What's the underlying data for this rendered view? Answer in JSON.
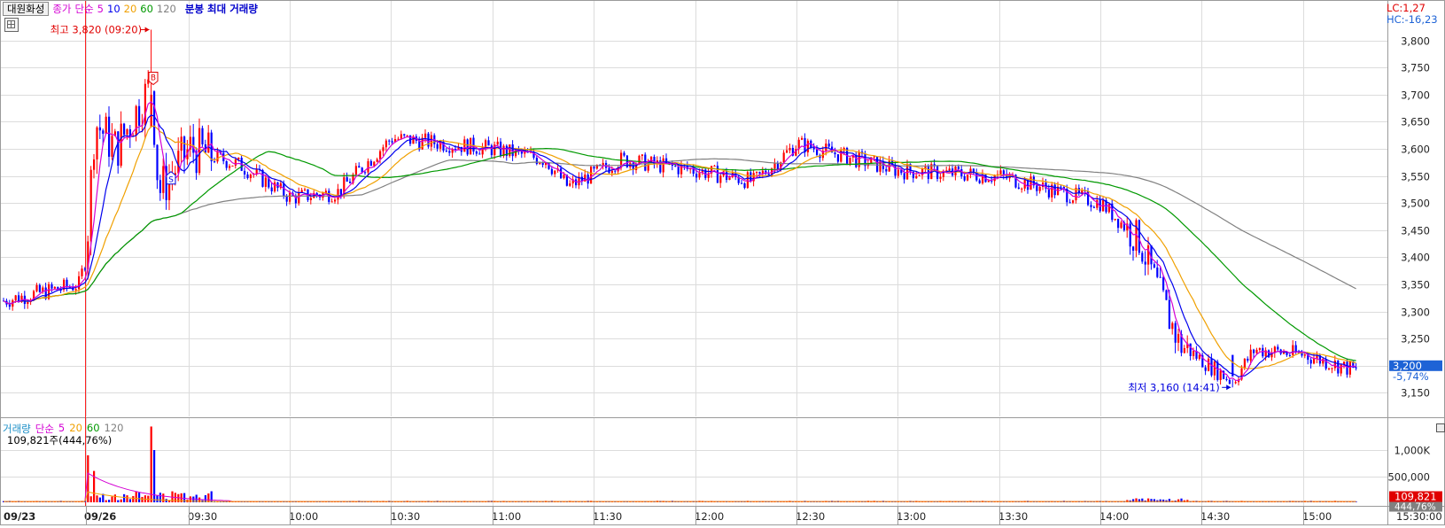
{
  "header": {
    "stock_name": "대원화성",
    "indicators": [
      {
        "label": "종가",
        "color": "#d400d4"
      },
      {
        "label": "단순",
        "color": "#d400d4"
      },
      {
        "label": "5",
        "color": "#d400d4"
      },
      {
        "label": "10",
        "color": "#0000ee"
      },
      {
        "label": "20",
        "color": "#f0a000"
      },
      {
        "label": "60",
        "color": "#009900"
      },
      {
        "label": "120",
        "color": "#808080"
      }
    ],
    "chart_label": "분봉 최대 거래량",
    "lc": "LC:1,27",
    "hc": "HC:-16,23"
  },
  "volume_header": {
    "title": "거래량",
    "ma_type": "단순",
    "ma_periods": [
      "5",
      "20",
      "60",
      "120"
    ],
    "current": "109,821주(444,76%)"
  },
  "price_tags": {
    "current_price": "3,200",
    "current_change": "-5,74%",
    "volume_value": "109,821",
    "volume_pct": "444,76%"
  },
  "annotations": {
    "high": "최고 3,820 (09:20)",
    "low": "최저 3,160 (14:41)",
    "buy_marker": "B",
    "sell_marker": "S"
  },
  "colors": {
    "up": "#ff0000",
    "down": "#0000ff",
    "ma5": "#d400d4",
    "ma10": "#0000ee",
    "ma20": "#f0a000",
    "ma60": "#009900",
    "ma120": "#808080",
    "grid": "#dcdcdc",
    "tag_bg": "#1e63d6"
  },
  "chart_data": [
    {
      "type": "candlestick",
      "title": "대원화성 분봉",
      "y_ticks": [
        3150,
        3200,
        3250,
        3300,
        3350,
        3400,
        3450,
        3500,
        3550,
        3600,
        3650,
        3700,
        3750,
        3800
      ],
      "ylim": [
        3120,
        3830
      ],
      "x_tick_labels": [
        "09/23",
        "09/26",
        "09:30",
        "10:00",
        "10:30",
        "11:00",
        "11:30",
        "12:00",
        "12:30",
        "13:00",
        "13:30",
        "14:00",
        "14:30",
        "15:00",
        "15:30:00"
      ],
      "high_point": {
        "value": 3820,
        "time": "09:20"
      },
      "low_point": {
        "value": 3160,
        "time": "14:41"
      },
      "close_keyframes": [
        {
          "t": "09/23",
          "p": 3320
        },
        {
          "t": "09/23 late",
          "p": 3350
        },
        {
          "t": "09:00",
          "p": 3400
        },
        {
          "t": "09:05",
          "p": 3650
        },
        {
          "t": "09:12",
          "p": 3600
        },
        {
          "t": "09:20",
          "p": 3720
        },
        {
          "t": "09:23",
          "p": 3520
        },
        {
          "t": "09:30",
          "p": 3600
        },
        {
          "t": "09:45",
          "p": 3570
        },
        {
          "t": "10:00",
          "p": 3510
        },
        {
          "t": "10:15",
          "p": 3520
        },
        {
          "t": "10:30",
          "p": 3620
        },
        {
          "t": "11:00",
          "p": 3600
        },
        {
          "t": "11:15",
          "p": 3580
        },
        {
          "t": "11:30",
          "p": 3530
        },
        {
          "t": "11:45",
          "p": 3580
        },
        {
          "t": "12:00",
          "p": 3560
        },
        {
          "t": "12:15",
          "p": 3540
        },
        {
          "t": "12:30",
          "p": 3610
        },
        {
          "t": "13:00",
          "p": 3560
        },
        {
          "t": "13:30",
          "p": 3550
        },
        {
          "t": "14:00",
          "p": 3500
        },
        {
          "t": "14:10",
          "p": 3430
        },
        {
          "t": "14:20",
          "p": 3240
        },
        {
          "t": "14:41",
          "p": 3170
        },
        {
          "t": "14:50",
          "p": 3230
        },
        {
          "t": "15:00",
          "p": 3220
        },
        {
          "t": "15:10",
          "p": 3190
        }
      ],
      "ma_end_values": {
        "ma5": 3195,
        "ma10": 3200,
        "ma20": 3210,
        "ma60": 3235,
        "ma120": 3385
      }
    },
    {
      "type": "bar",
      "title": "거래량",
      "y_ticks": [
        "500,000",
        "1,000K"
      ],
      "current_volume": 109821,
      "spikes": [
        {
          "t": "09:00",
          "v": 900000
        },
        {
          "t": "09:05",
          "v": 600000
        },
        {
          "t": "09:20",
          "v": 1450000
        },
        {
          "t": "09:22",
          "v": 1000000
        }
      ]
    }
  ]
}
